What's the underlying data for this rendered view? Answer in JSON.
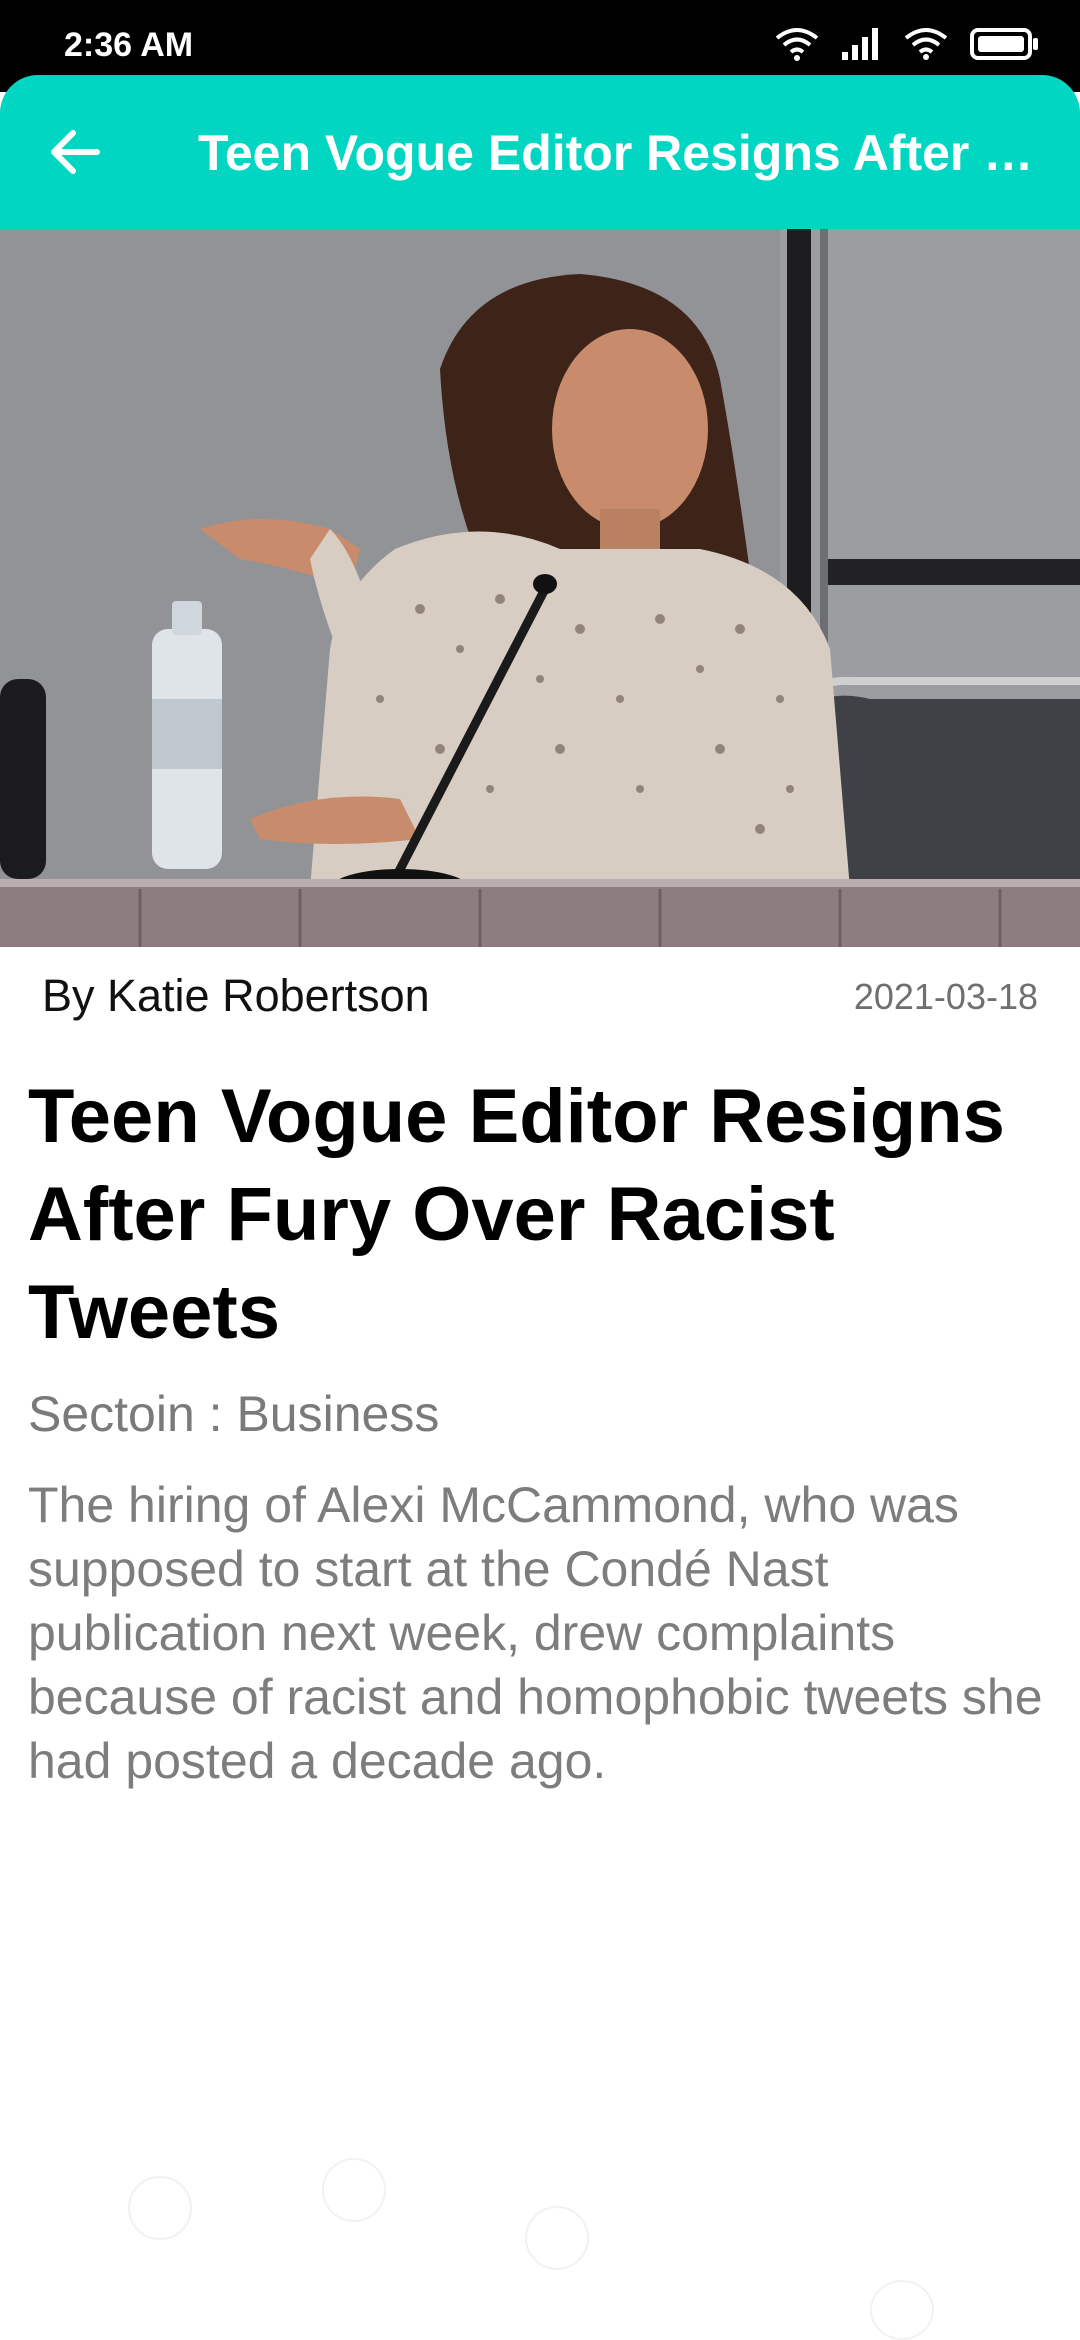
{
  "status_bar": {
    "time": "2:36 AM",
    "icons": [
      "wifi-icon",
      "signal-icon",
      "wifi-icon",
      "battery-icon"
    ]
  },
  "app_bar": {
    "title": "Teen Vogue Editor Resigns After Fury Over Racist Tweets",
    "back_icon": "arrow-left-icon",
    "color": "#00d6c1"
  },
  "article": {
    "byline": "By Katie Robertson",
    "date": "2021-03-18",
    "headline": "Teen Vogue Editor Resigns After Fury Over Racist Tweets",
    "section": "Sectoin : Business",
    "summary": "The hiring of Alexi McCammond, who was supposed to start at the Condé Nast publication next week, drew complaints because of racist and homophobic tweets she had posted a decade ago."
  }
}
